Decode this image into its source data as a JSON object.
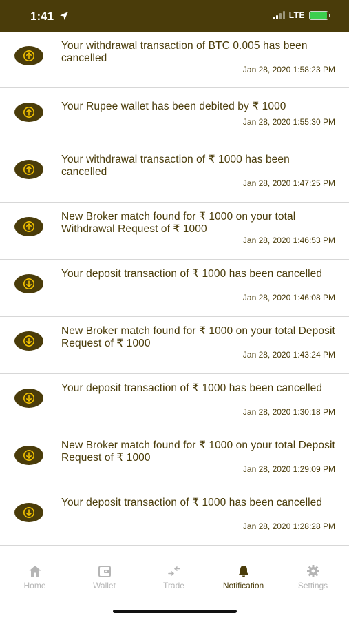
{
  "status_bar": {
    "time": "1:41",
    "network": "LTE",
    "location_icon": "location-arrow-icon",
    "colors": {
      "background": "#4a3c0a",
      "battery": "#3ccf4e"
    }
  },
  "theme": {
    "accent": "#4a3c0a",
    "inactive": "#b5b5b5"
  },
  "notifications": [
    {
      "direction": "up",
      "icon": "arrow-up-icon",
      "message": "Your withdrawal transaction of BTC 0.005 has been cancelled",
      "timestamp": "Jan 28, 2020 1:58:23 PM"
    },
    {
      "direction": "up",
      "icon": "arrow-up-icon",
      "message": "Your Rupee wallet has been debited by ₹ 1000",
      "timestamp": "Jan 28, 2020 1:55:30 PM"
    },
    {
      "direction": "up",
      "icon": "arrow-up-icon",
      "message": "Your withdrawal transaction of ₹ 1000 has been cancelled",
      "timestamp": "Jan 28, 2020 1:47:25 PM"
    },
    {
      "direction": "up",
      "icon": "arrow-up-icon",
      "message": "New Broker match found for ₹ 1000 on your total Withdrawal Request of ₹ 1000",
      "timestamp": "Jan 28, 2020 1:46:53 PM"
    },
    {
      "direction": "down",
      "icon": "arrow-down-icon",
      "message": "Your deposit transaction of ₹ 1000 has been cancelled",
      "timestamp": "Jan 28, 2020 1:46:08 PM"
    },
    {
      "direction": "down",
      "icon": "arrow-down-icon",
      "message": "New Broker match found for ₹ 1000 on your total Deposit Request of ₹ 1000",
      "timestamp": "Jan 28, 2020 1:43:24 PM"
    },
    {
      "direction": "down",
      "icon": "arrow-down-icon",
      "message": "Your deposit transaction of ₹ 1000 has been cancelled",
      "timestamp": "Jan 28, 2020 1:30:18 PM"
    },
    {
      "direction": "down",
      "icon": "arrow-down-icon",
      "message": "New Broker match found for ₹ 1000 on your total Deposit Request of ₹ 1000",
      "timestamp": "Jan 28, 2020 1:29:09 PM"
    },
    {
      "direction": "down",
      "icon": "arrow-down-icon",
      "message": "Your deposit transaction of ₹ 1000 has been cancelled",
      "timestamp": "Jan 28, 2020 1:28:28 PM"
    }
  ],
  "tab_bar": {
    "tabs": [
      {
        "label": "Home",
        "icon": "home-icon",
        "active": false
      },
      {
        "label": "Wallet",
        "icon": "wallet-icon",
        "active": false
      },
      {
        "label": "Trade",
        "icon": "trade-arrows-icon",
        "active": false
      },
      {
        "label": "Notification",
        "icon": "bell-icon",
        "active": true
      },
      {
        "label": "Settings",
        "icon": "gear-icon",
        "active": false
      }
    ]
  }
}
